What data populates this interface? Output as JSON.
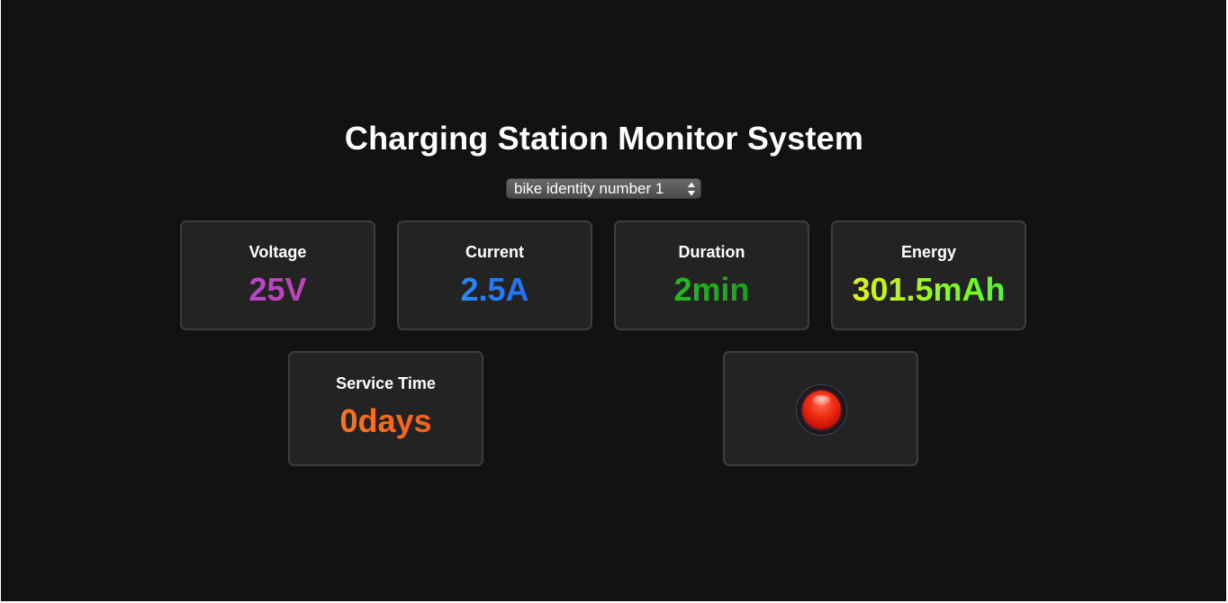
{
  "header": {
    "title": "Charging Station Monitor System"
  },
  "bike_select": {
    "selected": "bike identity number 1",
    "icon": "updown-arrows-icon"
  },
  "metrics": {
    "voltage": {
      "label": "Voltage",
      "value": "25V",
      "colors": [
        "#b44be0",
        "#c43e9e"
      ]
    },
    "current": {
      "label": "Current",
      "value": "2.5A",
      "colors": [
        "#2f9bff",
        "#1d5cf0"
      ]
    },
    "duration": {
      "label": "Duration",
      "value": "2min",
      "colors": [
        "#2fcf2a",
        "#0b8f10"
      ]
    },
    "energy": {
      "label": "Energy",
      "value": "301.5mAh",
      "colors": [
        "#f4f20f",
        "#3dff2c"
      ]
    },
    "service_time": {
      "label": "Service Time",
      "value": "0days",
      "colors": [
        "#ff7d1e",
        "#f2561a"
      ]
    }
  },
  "status": {
    "icon": "red-status-light-icon",
    "color": "#e8210c"
  }
}
